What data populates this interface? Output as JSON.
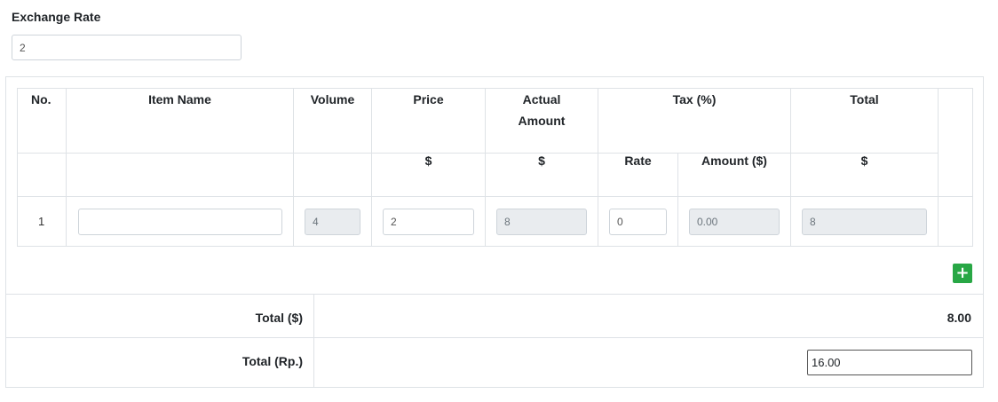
{
  "exchange_rate": {
    "label": "Exchange Rate",
    "value": "2"
  },
  "table": {
    "headers": {
      "no": "No.",
      "item_name": "Item Name",
      "volume": "Volume",
      "price": "Price",
      "actual_amount": "Actual Amount",
      "tax": "Tax (%)",
      "total": "Total"
    },
    "subheaders": {
      "price_currency": "$",
      "actual_currency": "$",
      "tax_rate": "Rate",
      "tax_amount": "Amount ($)",
      "total_currency": "$"
    },
    "rows": [
      {
        "no": "1",
        "item_name": "",
        "volume": "4",
        "price": "2",
        "actual_amount": "8",
        "tax_rate": "0",
        "tax_amount": "0.00",
        "total": "8"
      }
    ]
  },
  "add_row_icon": "plus-icon",
  "add_row_symbol": "+",
  "summary": {
    "total_usd_label": "Total ($)",
    "total_usd_value": "8.00",
    "total_rp_label": "Total (Rp.)",
    "total_rp_value": "16.00"
  },
  "colors": {
    "add_button": "#28a745",
    "readonly_field": "#e9ecef",
    "border": "#dee2e6"
  }
}
